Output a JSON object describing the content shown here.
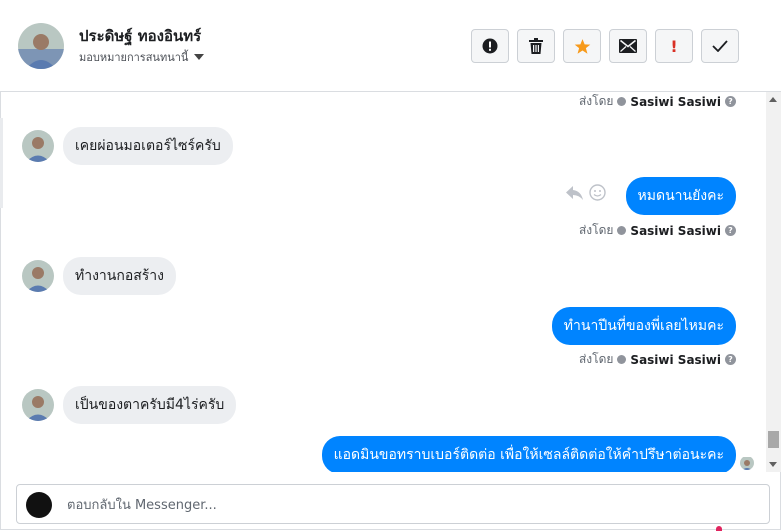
{
  "header": {
    "contact_name": "ประดิษฐ์ ทองอินทร์",
    "assign_label": "มอบหมายการสนทนานี้",
    "toolbar": [
      {
        "name": "mark-spam-button",
        "icon": "alert-circle-icon"
      },
      {
        "name": "delete-button",
        "icon": "trash-icon"
      },
      {
        "name": "star-button",
        "icon": "star-icon"
      },
      {
        "name": "mark-unread-button",
        "icon": "envelope-icon"
      },
      {
        "name": "follow-up-button",
        "icon": "exclamation-icon"
      },
      {
        "name": "mark-done-button",
        "icon": "check-icon"
      }
    ],
    "star_color": "#f79a1b",
    "followup_glyph": "!"
  },
  "sent_by": {
    "label": "ส่งโดย",
    "who": "Sasiwi Sasiwi",
    "help_glyph": "?"
  },
  "messages": {
    "in1": "เคยผ่อนมอเตอร์ไซร์ครับ",
    "out1": "หมดนานยังคะ",
    "in2": "ทำงานกอสร้าง",
    "out2": "ทำนาปีนที่ของพี่เลยไหมคะ",
    "in3": "เป็นของตาครับมี4ไร่ครับ",
    "out3": "แอดมินขอทราบเบอร์ติดต่อ เพื่อให้เซลล์ติดต่อให้คำปรึษาต่อนะคะ"
  },
  "colors": {
    "accent": "#0084ff",
    "incoming_bubble": "#eceef1"
  },
  "reply": {
    "placeholder": "ตอบกลับใน Messenger..."
  }
}
